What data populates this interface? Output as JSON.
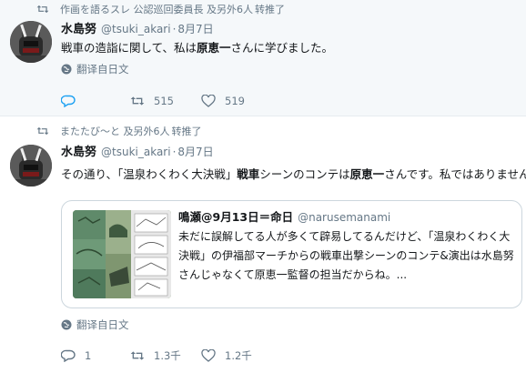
{
  "tweets": [
    {
      "retweet_context": {
        "users": "作画を語るスレ 公認巡回委員長 及另外6人",
        "action": "转推了"
      },
      "author": {
        "name": "水島努",
        "handle": "@tsuki_akari",
        "separator": "·",
        "date": "8月7日"
      },
      "body": {
        "before": "戦車の造詣に関して、私は",
        "bold": "原恵一",
        "after": "さんに学びました。"
      },
      "translate_label": "翻译自日文",
      "actions": {
        "reply_count": "",
        "retweet_count": "515",
        "like_count": "519"
      }
    },
    {
      "retweet_context": {
        "users": "またたび〜と 及另外6人",
        "action": "转推了"
      },
      "author": {
        "name": "水島努",
        "handle": "@tsuki_akari",
        "separator": "·",
        "date": "8月7日"
      },
      "body": {
        "part1": "その通り、「温泉わくわく大決戦」",
        "bold1": "戦車",
        "part2": "シーンのコンテは",
        "bold2": "原恵一",
        "part3": "さんです。私ではありません。"
      },
      "quote": {
        "name": "鳴瀬@9月13日＝命日",
        "handle": "@narusemanami",
        "text": "未だに誤解してる人が多くて辟易してるんだけど、「温泉わくわく大決戦」の伊福部マーチからの戦車出撃シーンのコンテ&演出は水島努さんじゃなくて原恵一監督の担当だからね。..."
      },
      "translate_label": "翻译自日文",
      "actions": {
        "reply_count": "1",
        "retweet_count": "1.3千",
        "like_count": "1.2千"
      }
    }
  ],
  "colors": {
    "accent": "#1da1f2",
    "muted": "#657786",
    "text": "#14171a",
    "highlight_bg": "#f5f8fa",
    "border": "#e6ecf0"
  },
  "icons": [
    "retweet-icon",
    "reply-icon",
    "like-icon",
    "globe-icon",
    "avatar-robot"
  ]
}
